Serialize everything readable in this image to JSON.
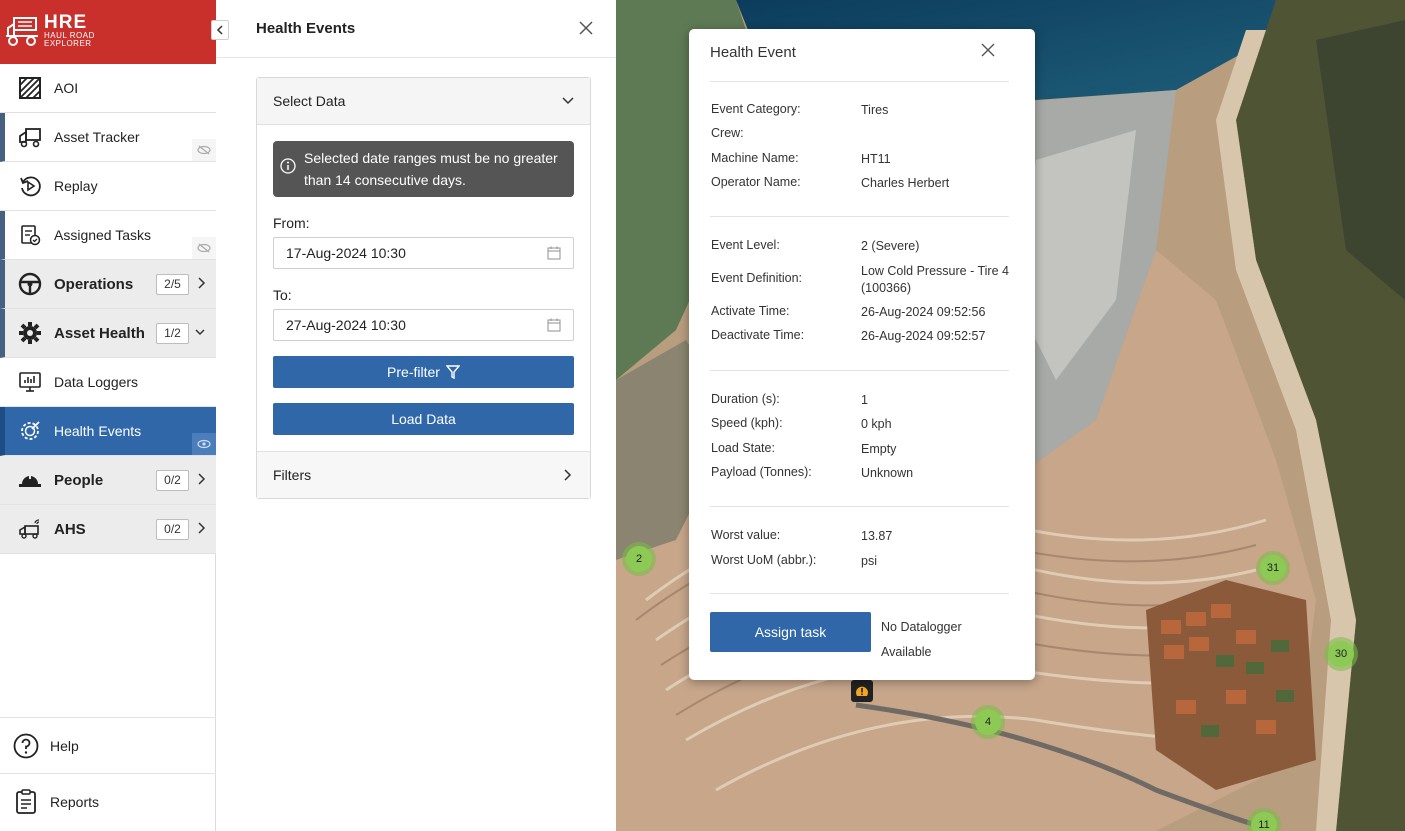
{
  "brand": {
    "title": "HRE",
    "subtitle": "HAUL ROAD EXPLORER"
  },
  "nav": {
    "items": [
      {
        "label": "AOI",
        "icon": "aoi-hatch-icon"
      },
      {
        "label": "Asset Tracker",
        "icon": "truck-icon"
      },
      {
        "label": "Replay",
        "icon": "replay-icon"
      },
      {
        "label": "Assigned Tasks",
        "icon": "tasks-icon"
      },
      {
        "label": "Operations",
        "icon": "steering-wheel-icon",
        "badge": "2/5"
      },
      {
        "label": "Asset Health",
        "icon": "gear-icon",
        "badge": "1/2"
      },
      {
        "label": "Data Loggers",
        "icon": "monitor-chart-icon"
      },
      {
        "label": "Health Events",
        "icon": "gear-wrench-icon"
      },
      {
        "label": "People",
        "icon": "hard-hat-icon",
        "badge": "0/2"
      },
      {
        "label": "AHS",
        "icon": "autonomous-truck-icon",
        "badge": "0/2"
      }
    ],
    "help": "Help",
    "reports": "Reports"
  },
  "panel": {
    "title": "Health Events",
    "select_data": "Select Data",
    "alert": "Selected date ranges must be no greater than 14 consecutive days.",
    "from_label": "From:",
    "from_value": "17-Aug-2024 10:30",
    "to_label": "To:",
    "to_value": "27-Aug-2024 10:30",
    "prefilter": "Pre-filter",
    "load_data": "Load Data",
    "filters": "Filters"
  },
  "map": {
    "clusters": [
      "2",
      "31",
      "30",
      "4",
      "11"
    ]
  },
  "popup": {
    "title": "Health Event",
    "event_category_label": "Event Category:",
    "event_category": "Tires",
    "crew_label": "Crew:",
    "crew": "",
    "machine_name_label": "Machine Name:",
    "machine_name": "HT11",
    "operator_name_label": "Operator Name:",
    "operator_name": "Charles Herbert",
    "event_level_label": "Event Level:",
    "event_level": "2 (Severe)",
    "event_definition_label": "Event Definition:",
    "event_definition": "Low Cold Pressure - Tire 4 (100366)",
    "activate_time_label": "Activate Time:",
    "activate_time": "26-Aug-2024 09:52:56",
    "deactivate_time_label": "Deactivate Time:",
    "deactivate_time": "26-Aug-2024 09:52:57",
    "duration_label": "Duration (s):",
    "duration": "1",
    "speed_label": "Speed (kph):",
    "speed": "0 kph",
    "load_state_label": "Load State:",
    "load_state": "Empty",
    "payload_label": "Payload (Tonnes):",
    "payload": "Unknown",
    "worst_value_label": "Worst value:",
    "worst_value": "13.87",
    "worst_uom_label": "Worst UoM (abbr.):",
    "worst_uom": "psi",
    "assign_task": "Assign task",
    "no_datalogger": "No Datalogger Available"
  },
  "colors": {
    "brand_red": "#c9302c",
    "primary_blue": "#2f67a8",
    "cluster_green": "#8cca55"
  }
}
